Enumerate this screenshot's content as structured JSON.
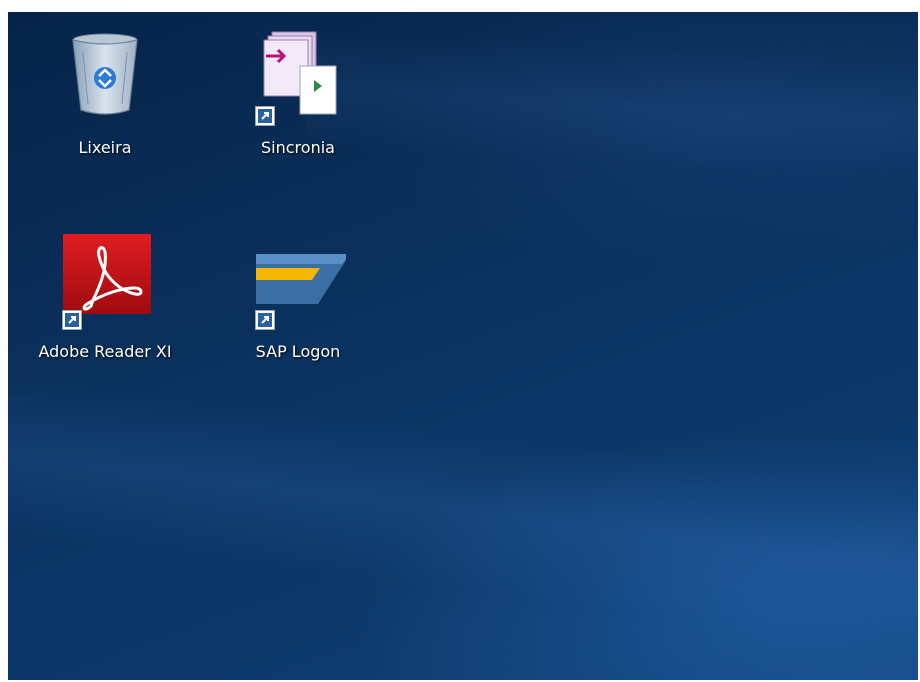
{
  "desktop": {
    "icons": [
      {
        "label": "Lixeira",
        "icon": "recycle-bin-icon"
      },
      {
        "label": "Sincronia",
        "icon": "sync-app-icon"
      },
      {
        "label": "Adobe Reader XI",
        "icon": "adobe-reader-icon"
      },
      {
        "label": "SAP Logon",
        "icon": "sap-logon-icon"
      }
    ]
  },
  "colors": {
    "wallpaper_dark": "#06244a",
    "wallpaper_mid": "#0b3564",
    "adobe_red": "#c8102e",
    "sap_blue": "#3a6ea5",
    "sap_yellow": "#f2b705"
  }
}
